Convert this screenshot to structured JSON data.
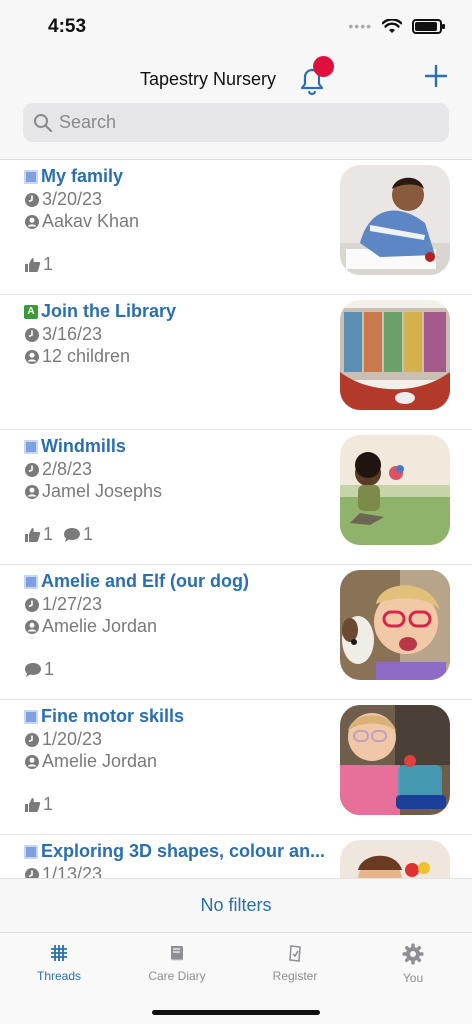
{
  "status": {
    "time": "4:53"
  },
  "header": {
    "title": "Tapestry Nursery",
    "search_placeholder": "Search"
  },
  "threads": [
    {
      "title": "My family",
      "type": "observation",
      "date": "3/20/23",
      "person": "Aakav Khan",
      "likes": "1",
      "comments": ""
    },
    {
      "title": "Join the Library",
      "type": "activity",
      "date": "3/16/23",
      "person": "12 children",
      "likes": "",
      "comments": ""
    },
    {
      "title": "Windmills",
      "type": "observation",
      "date": "2/8/23",
      "person": "Jamel Josephs",
      "likes": "1",
      "comments": "1"
    },
    {
      "title": "Amelie and Elf (our dog)",
      "type": "observation",
      "date": "1/27/23",
      "person": "Amelie Jordan",
      "likes": "",
      "comments": "1"
    },
    {
      "title": "Fine motor skills",
      "type": "observation",
      "date": "1/20/23",
      "person": "Amelie Jordan",
      "likes": "1",
      "comments": ""
    },
    {
      "title": "Exploring 3D shapes, colour an...",
      "type": "observation",
      "date": "1/13/23",
      "person": "",
      "likes": "",
      "comments": ""
    }
  ],
  "filter": {
    "label": "No filters"
  },
  "tabs": [
    {
      "label": "Threads",
      "icon": "threads-icon",
      "active": true
    },
    {
      "label": "Care Diary",
      "icon": "book-icon",
      "active": false
    },
    {
      "label": "Register",
      "icon": "register-icon",
      "active": false
    },
    {
      "label": "You",
      "icon": "gear-icon",
      "active": false
    }
  ],
  "colors": {
    "accent": "#2a6fb0",
    "badge": "#e0103c"
  }
}
